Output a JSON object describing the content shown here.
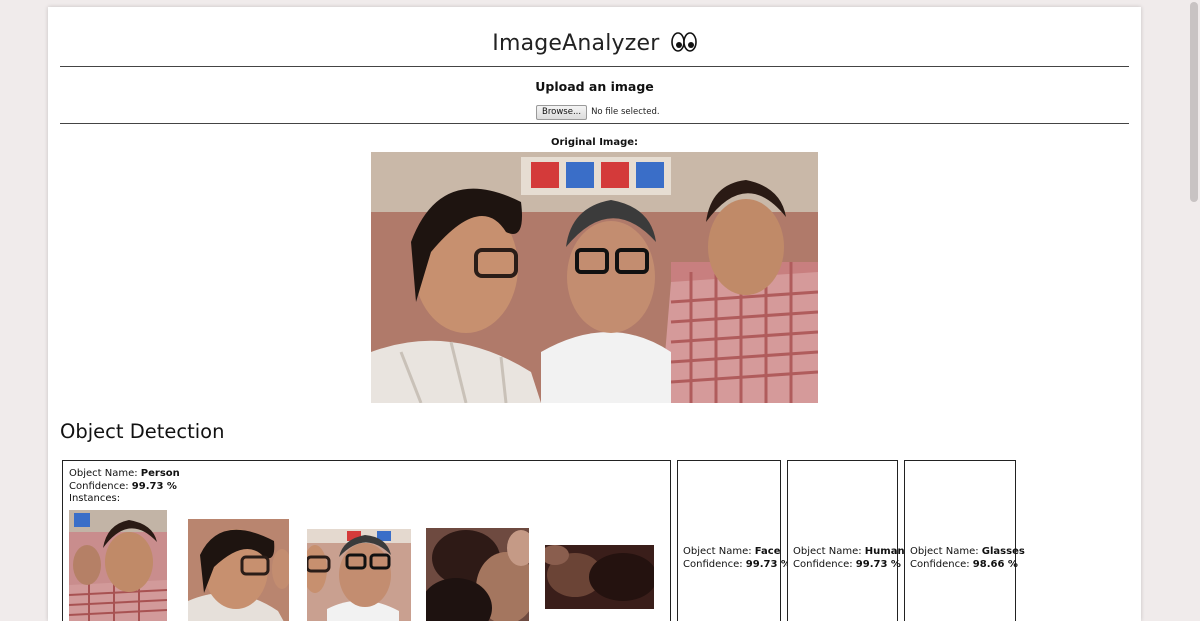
{
  "app": {
    "title": "ImageAnalyzer",
    "title_icon": "eyes-icon"
  },
  "upload": {
    "heading": "Upload an image",
    "browse_label": "Browse...",
    "file_status": "No file selected."
  },
  "original": {
    "label": "Original Image:"
  },
  "detection": {
    "title": "Object Detection",
    "name_label": "Object Name: ",
    "confidence_label": "Confidence: ",
    "instances_label": "Instances:",
    "objects": [
      {
        "name": "Person",
        "confidence": "99.73 %"
      },
      {
        "name": "Face",
        "confidence": "99.73 %"
      },
      {
        "name": "Human",
        "confidence": "99.73 %"
      },
      {
        "name": "Glasses",
        "confidence": "98.66 %"
      }
    ]
  },
  "colors": {
    "page_bg": "#f0ebeb",
    "card_bg": "#ffffff",
    "rule": "#444444"
  }
}
